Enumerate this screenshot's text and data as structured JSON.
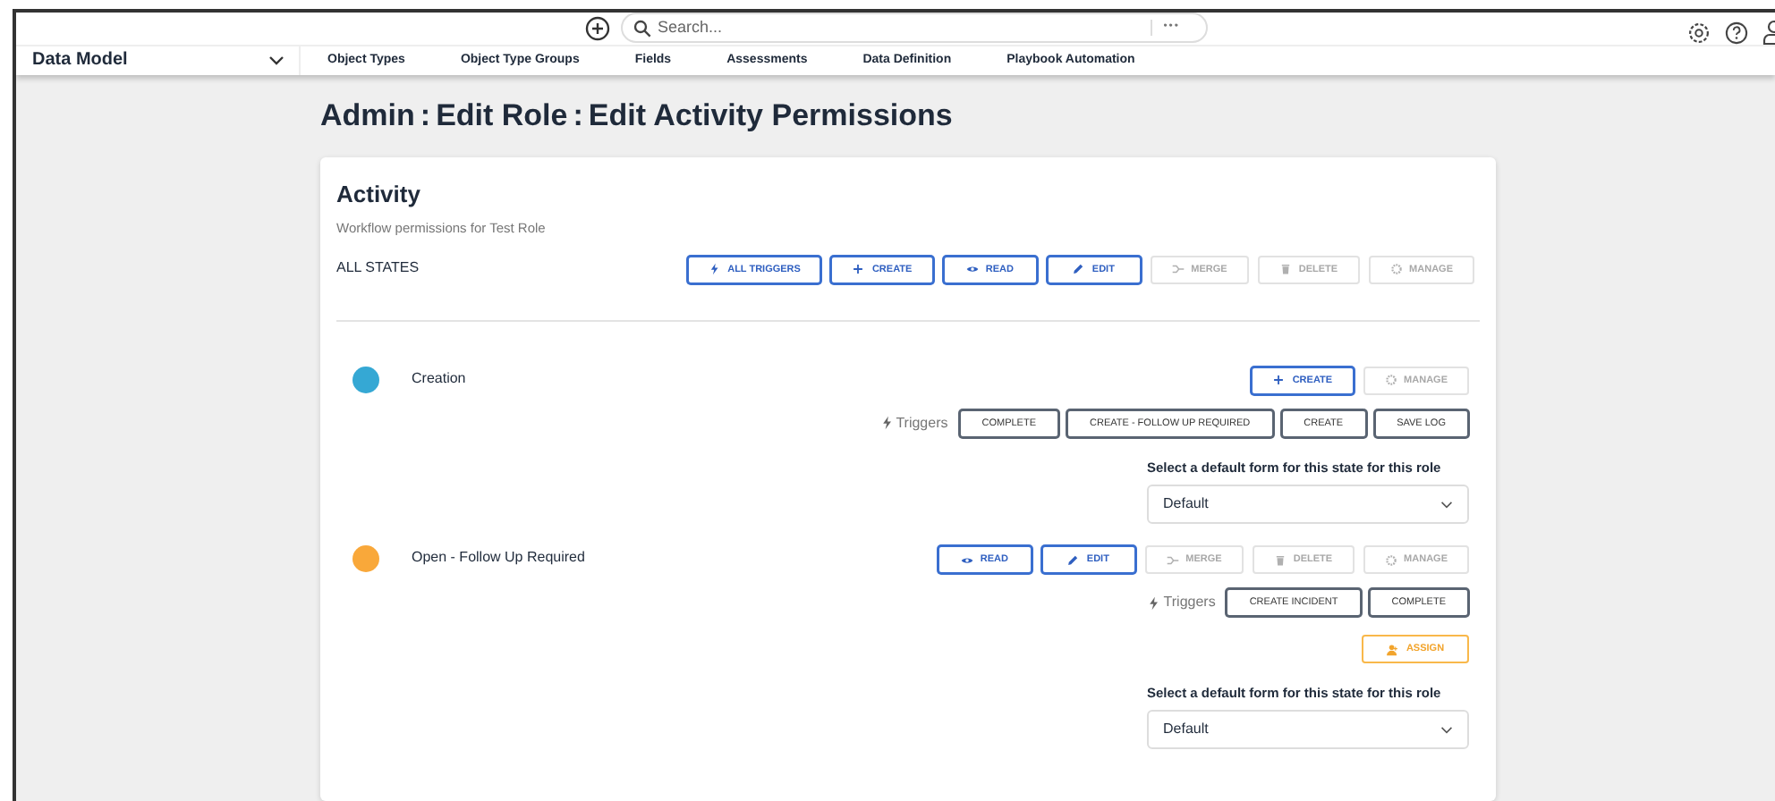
{
  "topbar": {
    "search": {
      "placeholder": "Search..."
    },
    "more": "•••"
  },
  "nav": {
    "section": "Data Model",
    "items": [
      {
        "label": "Object Types"
      },
      {
        "label": "Object Type Groups"
      },
      {
        "label": "Fields"
      },
      {
        "label": "Assessments"
      },
      {
        "label": "Data Definition"
      },
      {
        "label": "Playbook Automation"
      }
    ]
  },
  "breadcrumb": {
    "items": [
      "Admin",
      "Edit Role",
      "Edit Activity Permissions"
    ],
    "separator": ":"
  },
  "card": {
    "title": "Activity",
    "subtitle": "Workflow permissions for Test Role",
    "all_states": {
      "label": "ALL STATES",
      "buttons": [
        {
          "kind": "triggers",
          "label": "ALL TRIGGERS",
          "disabled": false
        },
        {
          "kind": "create",
          "label": "CREATE",
          "disabled": false
        },
        {
          "kind": "read",
          "label": "READ",
          "disabled": false
        },
        {
          "kind": "edit",
          "label": "EDIT",
          "disabled": false
        },
        {
          "kind": "merge",
          "label": "MERGE",
          "disabled": true
        },
        {
          "kind": "delete",
          "label": "DELETE",
          "disabled": true
        },
        {
          "kind": "manage",
          "label": "MANAGE",
          "disabled": true
        }
      ]
    },
    "states": [
      {
        "name": "Creation",
        "color": "#35a8d4",
        "buttons": [
          {
            "kind": "create",
            "label": "CREATE",
            "disabled": false
          },
          {
            "kind": "manage",
            "label": "MANAGE",
            "disabled": true
          }
        ],
        "triggers_label": "Triggers",
        "triggers": [
          "COMPLETE",
          "CREATE - FOLLOW UP REQUIRED",
          "CREATE",
          "SAVE LOG"
        ],
        "form_label": "Select a default form for this state for this role",
        "form_value": "Default"
      },
      {
        "name": "Open - Follow Up Required",
        "color": "#f9a83a",
        "buttons": [
          {
            "kind": "read",
            "label": "READ",
            "disabled": false
          },
          {
            "kind": "edit",
            "label": "EDIT",
            "disabled": false
          },
          {
            "kind": "merge",
            "label": "MERGE",
            "disabled": true
          },
          {
            "kind": "delete",
            "label": "DELETE",
            "disabled": true
          },
          {
            "kind": "manage",
            "label": "MANAGE",
            "disabled": true
          }
        ],
        "triggers_label": "Triggers",
        "triggers": [
          "CREATE INCIDENT",
          "COMPLETE"
        ],
        "assign": {
          "label": "ASSIGN",
          "disabled": false
        },
        "form_label": "Select a default form for this state for this role",
        "form_value": "Default"
      }
    ]
  }
}
